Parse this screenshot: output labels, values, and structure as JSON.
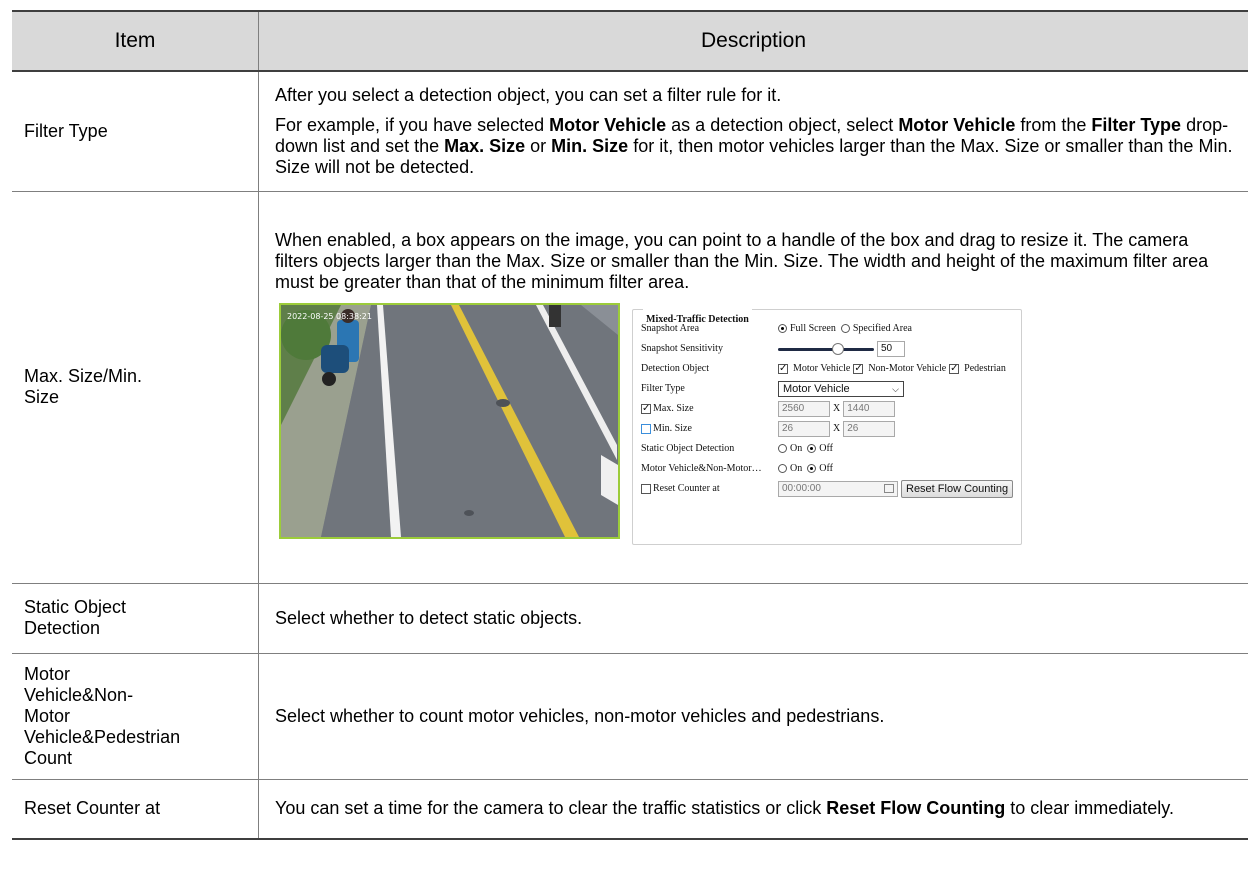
{
  "header": {
    "item": "Item",
    "description": "Description"
  },
  "rows": {
    "filter_type": {
      "item": "Filter Type",
      "p1": "After you select a detection object, you can set a filter rule for it.",
      "p2_a": "For example, if you have selected ",
      "p2_b": "Motor Vehicle",
      "p2_c": " as a detection object, select ",
      "p2_d": "Motor Vehicle",
      "p2_e": " from the ",
      "p2_f": "Filter Type",
      "p2_g": " drop-down list and set the ",
      "p2_h": "Max. Size",
      "p2_i": " or ",
      "p2_j": "Min. Size",
      "p2_k": " for it, then motor vehicles larger than the Max. Size or smaller than the Min. Size will not be detected."
    },
    "max_min_size": {
      "item": "Max. Size/Min. Size",
      "p1": "When enabled, a box appears on the image, you can point to a handle of the box and drag to resize it. The camera filters objects larger than the Max. Size or smaller than the Min. Size. The width and height of the maximum filter area must be greater than that of the minimum filter area."
    },
    "static_object": {
      "item": "Static Object Detection",
      "p1": "Select whether to detect static objects."
    },
    "count": {
      "item": "Motor Vehicle&Non-Motor Vehicle&Pedestrian Count",
      "p1": "Select whether to count motor vehicles, non-motor vehicles and pedestrians."
    },
    "reset_counter": {
      "item": "Reset Counter at",
      "p1_a": "You can set a time for the camera to clear the traffic statistics or click ",
      "p1_b": "Reset Flow Counting",
      "p1_c": " to clear immediately."
    }
  },
  "screenshot": {
    "panel_title": "Mixed-Traffic Detection",
    "snapshot_area": {
      "label": "Snapshot Area",
      "opt_full": "Full Screen",
      "opt_specified": "Specified Area",
      "selected": "Full Screen"
    },
    "snapshot_sensitivity": {
      "label": "Snapshot Sensitivity",
      "value": "50",
      "level": 0.6
    },
    "detection_object": {
      "label": "Detection Object",
      "motor": "Motor Vehicle",
      "non_motor": "Non-Motor Vehicle",
      "pedestrian": "Pedestrian"
    },
    "filter_type": {
      "label": "Filter Type",
      "value": "Motor Vehicle"
    },
    "max_size": {
      "label": "Max. Size",
      "w": "2560",
      "x": "X",
      "h": "1440"
    },
    "min_size": {
      "label": "Min. Size",
      "w": "26",
      "x": "X",
      "h": "26"
    },
    "static_detection": {
      "label": "Static Object Detection",
      "on": "On",
      "off": "Off"
    },
    "motor_count": {
      "label": "Motor Vehicle&Non-Motor…",
      "on": "On",
      "off": "Off"
    },
    "reset_counter": {
      "label": "Reset Counter at",
      "time": "00:00:00",
      "button": "Reset Flow Counting"
    },
    "camera_overlay": "2022-08-25 08:38:21"
  }
}
